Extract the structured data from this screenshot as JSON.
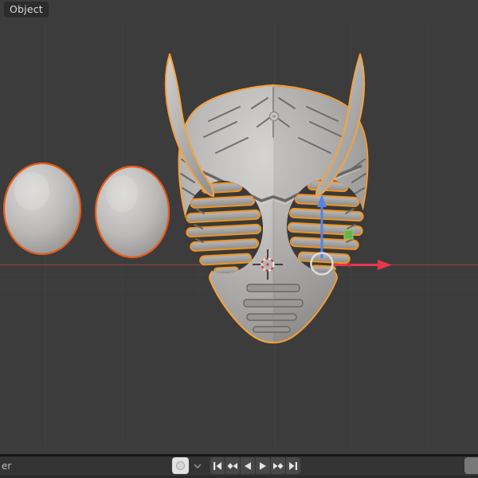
{
  "header": {
    "mode_label": "Object"
  },
  "viewport": {
    "scene_description": "3D viewport showing a selected horned rider-mask helmet mesh with slatted eye grills, plus two selected ovoid lens meshes on the left",
    "objects": [
      "ovoid-lens-left",
      "ovoid-lens-right",
      "horned-mask-helmet"
    ],
    "overlays": [
      "x-axis-line",
      "grid-lines",
      "3d-cursor"
    ],
    "gizmo_handles": [
      "move-gizmo-circle",
      "x-axis-arrow",
      "z-axis-arrow",
      "y-axis-square-handle",
      "axis-origin-dot"
    ]
  },
  "timeline": {
    "menu_cutoff_label": "er",
    "icons": [
      "auto-key-record-icon",
      "chevron-down-icon",
      "jump-to-start-icon",
      "previous-keyframe-icon",
      "play-reverse-icon",
      "play-icon",
      "next-keyframe-icon",
      "jump-to-end-icon"
    ]
  },
  "colors": {
    "viewport_bg": "#3c3c3c",
    "overlay_pill_bg": "#2c2c2c",
    "overlay_text": "#dcdcdc",
    "separator": "#161616",
    "timeline_bg": "#343434",
    "timeline_edge": "#2a2a2a",
    "button_bg": "#484848",
    "autokey_bg": "#e2e2e2",
    "field_bg": "#787878",
    "outline_active": "#f7a23e",
    "outline_select": "#e85a18",
    "outline_slat": "#ef9420",
    "axis_x_red": "#e8364e",
    "axis_x_dim": "#8e4545",
    "axis_z_blue": "#5583e8",
    "axis_y_green": "#6ab04c",
    "gizmo_circle": "#dcdcdc",
    "cursor_red": "#c8403e",
    "grid_line": "#474747"
  }
}
